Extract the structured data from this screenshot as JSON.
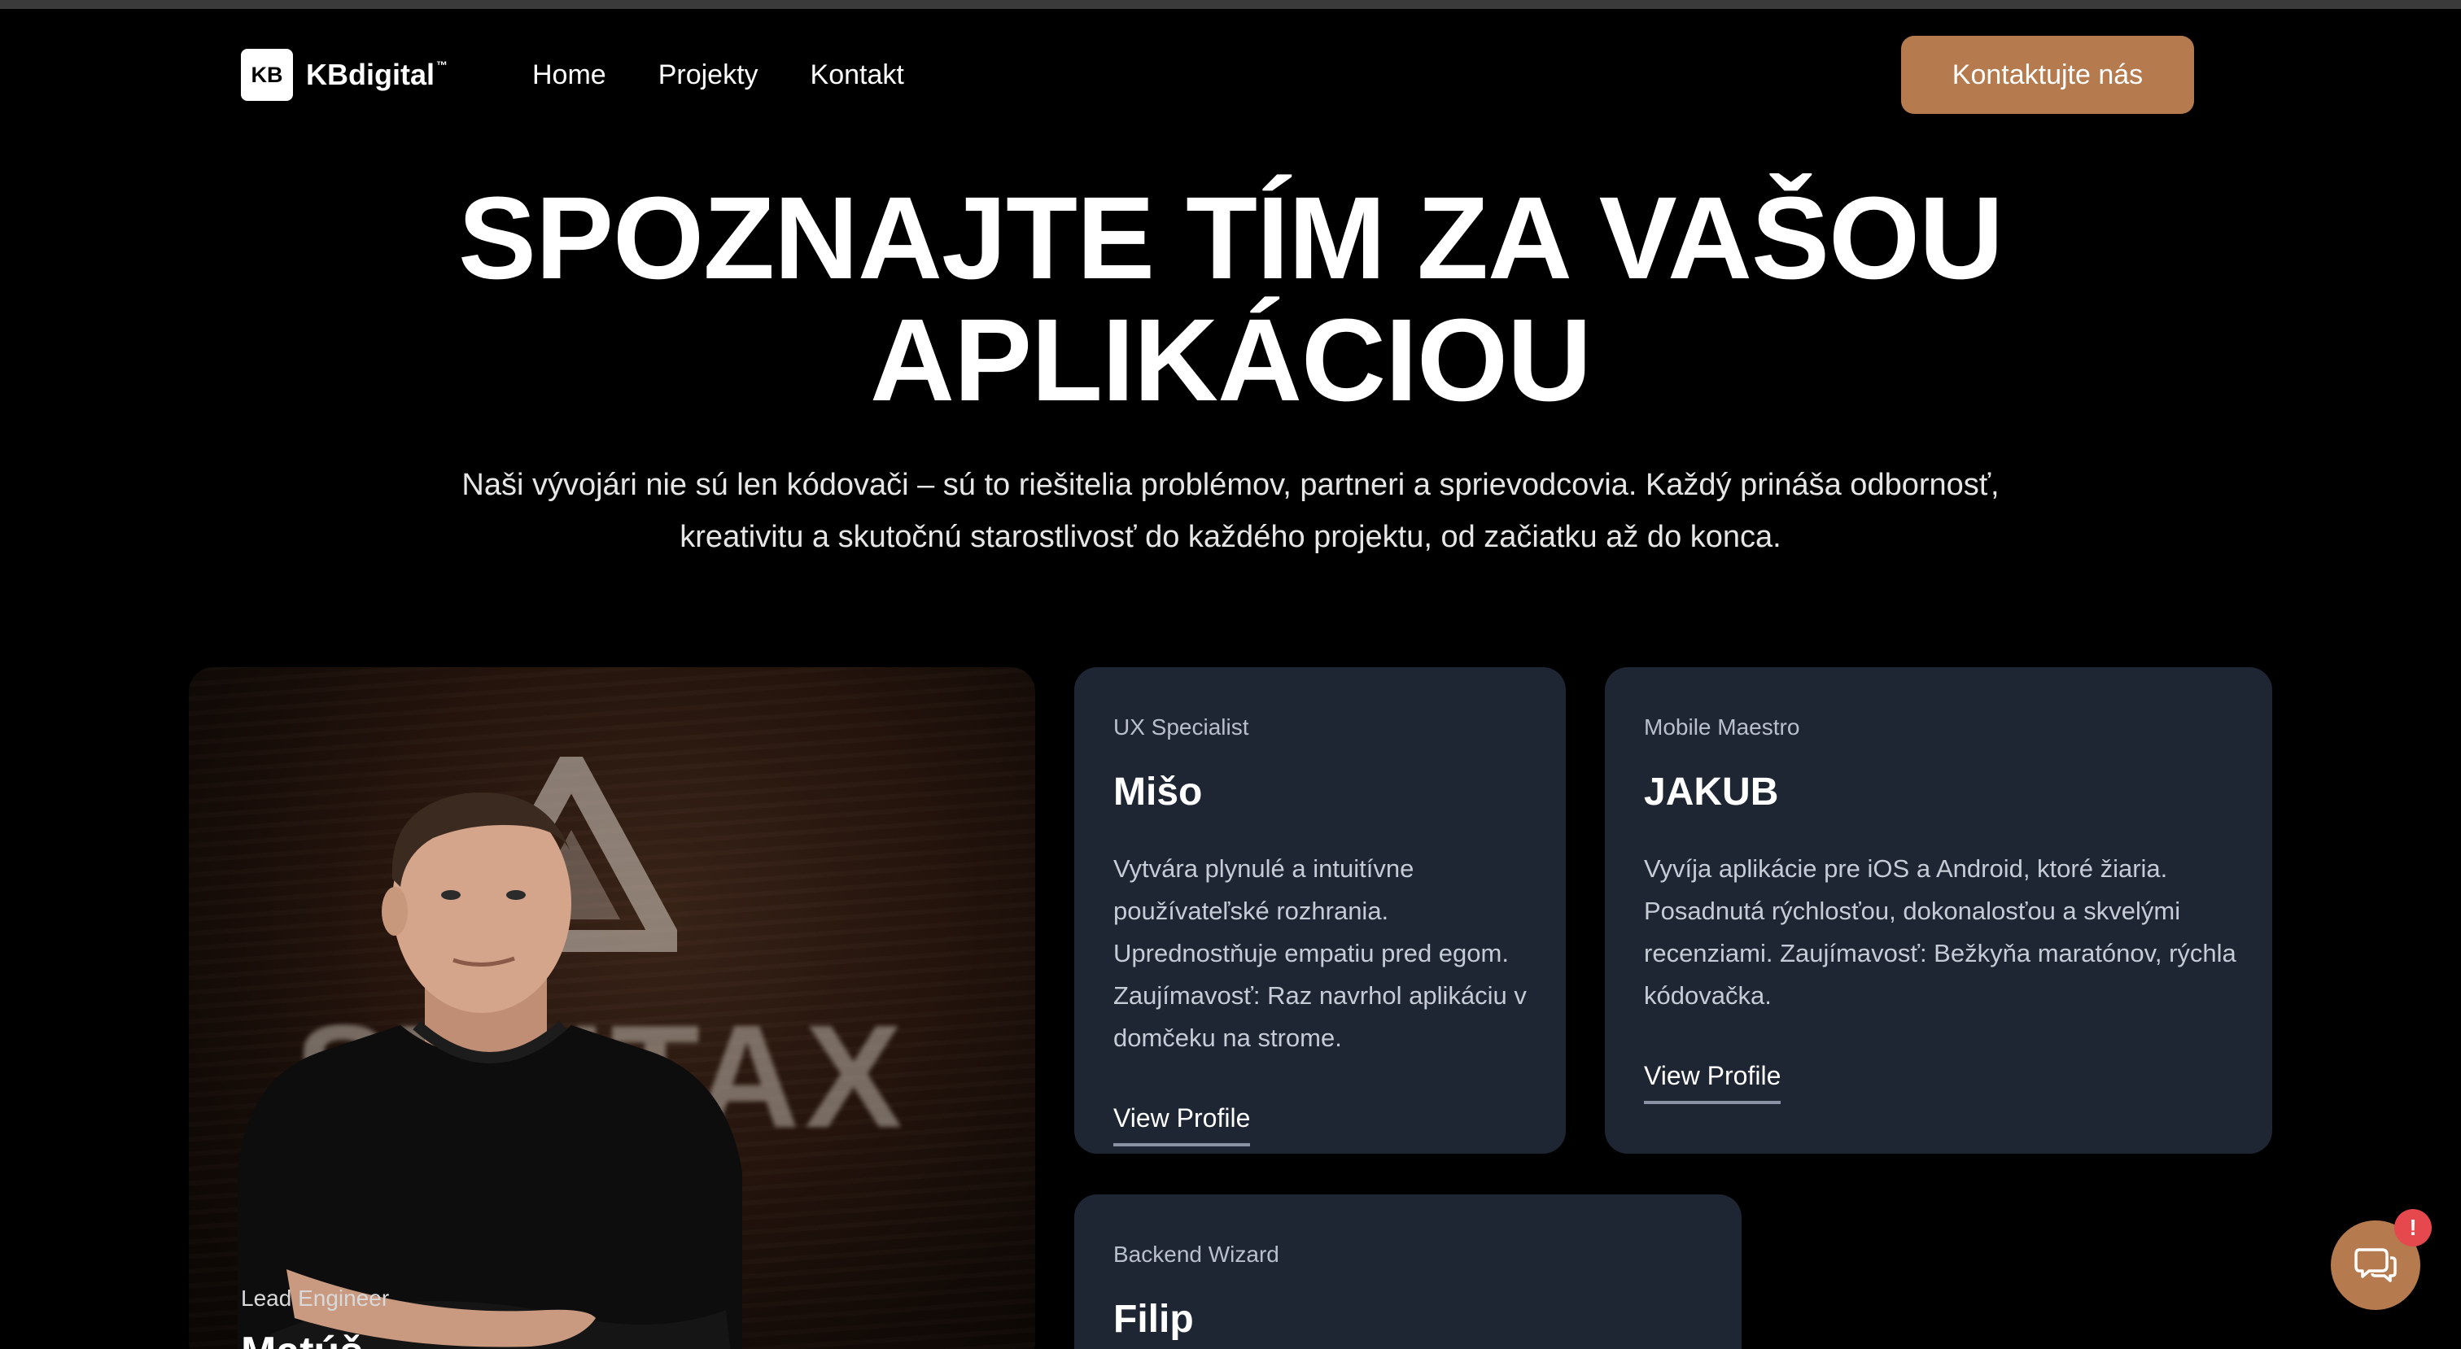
{
  "header": {
    "logo_badge": "KB",
    "logo_text": "KBdigital",
    "logo_tm": "™",
    "nav": [
      "Home",
      "Projekty",
      "Kontakt"
    ],
    "cta_label": "Kontaktujte nás"
  },
  "hero": {
    "title_line1": "SPOZNAJTE TÍM ZA VAŠOU",
    "title_line2": "APLIKÁCIOU",
    "subtitle": "Naši vývojári nie sú len kódovači – sú to riešitelia problémov, partneri a sprievodcovia. Každý prináša odbornosť, kreativitu a skutočnú starostlivosť do každého projektu, od začiatku až do konca."
  },
  "featured": {
    "role": "Lead Engineer",
    "name": "Matúš",
    "background_text": "SYNTAX"
  },
  "cards": [
    {
      "role": "UX Specialist",
      "name": "Mišo",
      "description": "Vytvára plynulé a intuitívne používateľské rozhrania. Uprednostňuje empatiu pred egom. Zaujímavosť: Raz navrhol aplikáciu v domčeku na strome.",
      "link": "View Profile"
    },
    {
      "role": "Mobile Maestro",
      "name": "JAKUB",
      "description": "Vyvíja aplikácie pre iOS a Android, ktoré žiaria. Posadnutá rýchlosťou, dokonalosťou a skvelými recenziami. Zaujímavosť: Bežkyňa maratónov, rýchla kódovačka.",
      "link": "View Profile"
    },
    {
      "role": "Backend Wizard",
      "name": "Filip"
    }
  ],
  "chat": {
    "badge": "!",
    "icon": "chat-bubbles-icon"
  },
  "colors": {
    "accent": "#b57b4e",
    "card_bg": "#1e2533",
    "badge": "#e5484d",
    "background": "#000000"
  }
}
